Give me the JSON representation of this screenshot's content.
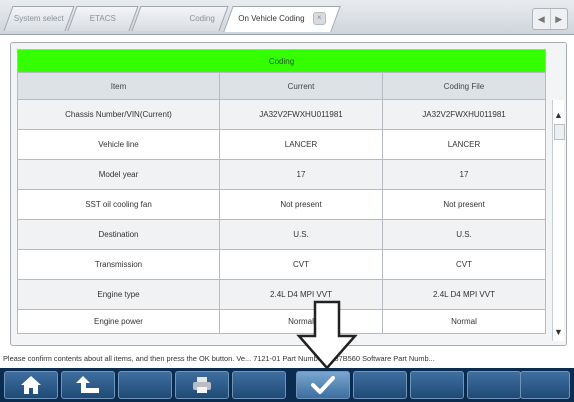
{
  "tabs": [
    {
      "label": "System select"
    },
    {
      "label": "ETACS"
    },
    {
      "label": "Coding"
    },
    {
      "label": "On Vehicle Coding"
    }
  ],
  "tab_close_label": "×",
  "nav": {
    "prev": "◀",
    "next": "▶"
  },
  "table": {
    "title": "Coding",
    "columns": [
      "Item",
      "Current",
      "Coding File"
    ],
    "rows": [
      {
        "item": "Chassis Number/VIN(Current)",
        "current": "JA32V2FWXHU011981",
        "file": "JA32V2FWXHU011981"
      },
      {
        "item": "Vehicle line",
        "current": "LANCER",
        "file": "LANCER"
      },
      {
        "item": "Model year",
        "current": "17",
        "file": "17"
      },
      {
        "item": "SST oil cooling fan",
        "current": "Not present",
        "file": "Not present"
      },
      {
        "item": "Destination",
        "current": "U.S.",
        "file": "U.S."
      },
      {
        "item": "Transmission",
        "current": "CVT",
        "file": "CVT"
      },
      {
        "item": "Engine type",
        "current": "2.4L D4 MPI VVT",
        "file": "2.4L D4 MPI VVT"
      },
      {
        "item": "Engine power",
        "current": "Normal",
        "file": "Normal"
      }
    ]
  },
  "scroll": {
    "up": "▲",
    "down": "▼"
  },
  "status_text": "Please confirm contents about all items, and then press the OK button.  Ve... 7121-01 Part Number 8637B560   Software Part Numb...",
  "toolbar": {
    "buttons": [
      {
        "icon": "home-icon"
      },
      {
        "icon": "back-icon"
      },
      {
        "icon": "blank"
      },
      {
        "icon": "printer-icon"
      },
      {
        "icon": "blank"
      },
      {
        "icon": "ok-check-icon"
      },
      {
        "icon": "blank"
      },
      {
        "icon": "blank"
      },
      {
        "icon": "blank"
      },
      {
        "icon": "blank"
      }
    ]
  },
  "colors": {
    "title_bar": "#33ff00",
    "toolbar_bg": "#0c2c4f",
    "toolbar_button": "#2f5e8c"
  }
}
